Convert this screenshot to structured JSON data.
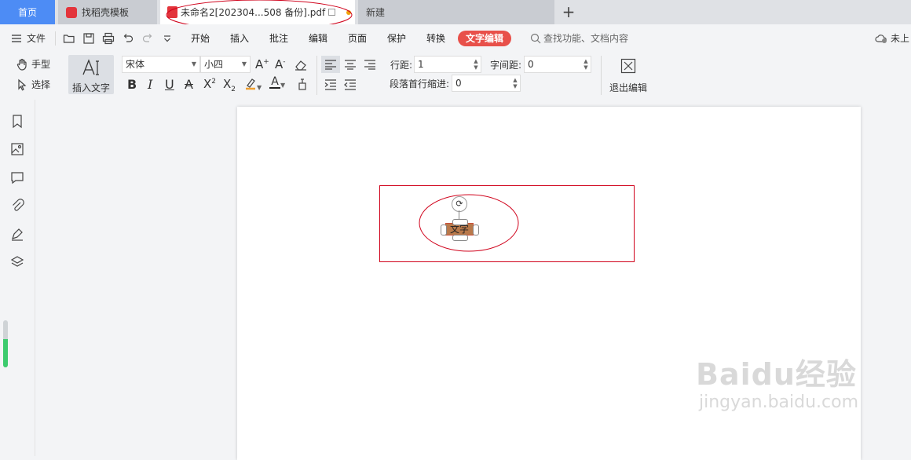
{
  "tabs": {
    "home": "首页",
    "template": "找稻壳模板",
    "document": "未命名2[202304...508 备份].pdf",
    "new": "新建"
  },
  "menu": {
    "file": "文件",
    "items": [
      "开始",
      "插入",
      "批注",
      "编辑",
      "页面",
      "保护",
      "转换"
    ],
    "active": "文字编辑",
    "search_placeholder": "查找功能、文档内容",
    "sync_status": "未上"
  },
  "ribbon": {
    "hand_tool": "手型",
    "select_tool": "选择",
    "insert_text": "插入文字",
    "font_name": "宋体",
    "font_size": "小四",
    "line_spacing_label": "行距:",
    "line_spacing_value": "1",
    "char_spacing_label": "字间距:",
    "char_spacing_value": "0",
    "indent_label": "段落首行缩进:",
    "indent_value": "0",
    "exit_edit": "退出编辑"
  },
  "canvas": {
    "text_box_content": "文字"
  },
  "watermark": {
    "brand": "Baidu经验",
    "url": "jingyan.baidu.com"
  },
  "colors": {
    "accent_blue": "#4d8cf5",
    "active_tab_red": "#e8504a",
    "annotation_red": "#d0021b",
    "highlight_orange": "#f0a030"
  }
}
